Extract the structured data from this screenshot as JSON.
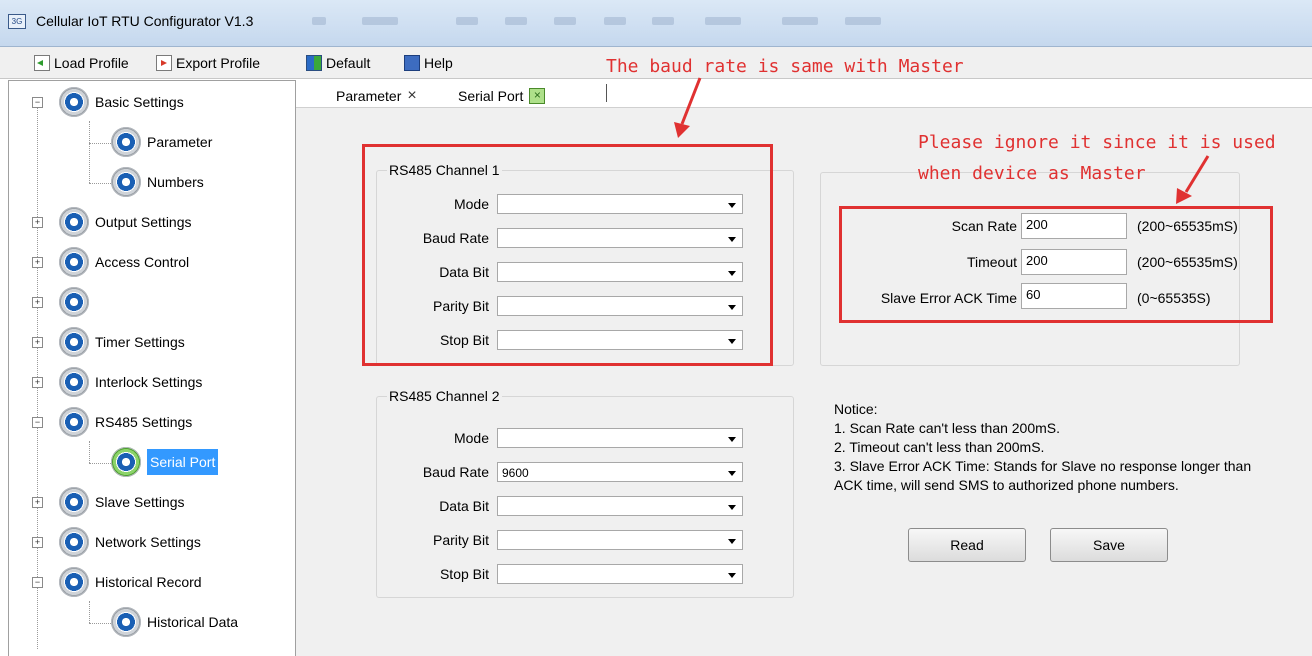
{
  "window": {
    "title": "Cellular IoT RTU Configurator V1.3"
  },
  "toolbar": {
    "load_profile": "Load Profile",
    "export_profile": "Export Profile",
    "default": "Default",
    "help": "Help"
  },
  "tree": {
    "items": [
      {
        "label": "Basic Settings",
        "expanded": true
      },
      {
        "label": "Parameter"
      },
      {
        "label": "Numbers"
      },
      {
        "label": "Output Settings",
        "expanded": false
      },
      {
        "label": "Access Control",
        "expanded": false
      },
      {
        "label": "",
        "expanded": false
      },
      {
        "label": "Timer Settings",
        "expanded": false
      },
      {
        "label": "Interlock Settings",
        "expanded": false
      },
      {
        "label": "RS485 Settings",
        "expanded": true
      },
      {
        "label": "Serial Port",
        "selected": true
      },
      {
        "label": "Slave Settings",
        "expanded": false
      },
      {
        "label": "Network Settings",
        "expanded": false
      },
      {
        "label": "Historical Record",
        "expanded": true
      },
      {
        "label": "Historical Data"
      }
    ]
  },
  "tabs": [
    {
      "label": "Parameter",
      "close": "×"
    },
    {
      "label": "Serial Port",
      "close": "×",
      "active": true
    }
  ],
  "channel1": {
    "title": "RS485 Channel 1",
    "fields": [
      {
        "label": "Mode",
        "value": ""
      },
      {
        "label": "Baud Rate",
        "value": ""
      },
      {
        "label": "Data Bit",
        "value": ""
      },
      {
        "label": "Parity Bit",
        "value": ""
      },
      {
        "label": "Stop Bit",
        "value": ""
      }
    ]
  },
  "channel2": {
    "title": "RS485 Channel 2",
    "fields": [
      {
        "label": "Mode",
        "value": ""
      },
      {
        "label": "Baud Rate",
        "value": "9600"
      },
      {
        "label": "Data Bit",
        "value": ""
      },
      {
        "label": "Parity Bit",
        "value": ""
      },
      {
        "label": "Stop Bit",
        "value": ""
      }
    ]
  },
  "master": {
    "fields": [
      {
        "label": "Scan Rate",
        "value": "200",
        "range": "(200~65535mS)"
      },
      {
        "label": "Timeout",
        "value": "200",
        "range": "(200~65535mS)"
      },
      {
        "label": "Slave Error ACK Time",
        "value": "60",
        "range": "(0~65535S)"
      }
    ]
  },
  "notice": {
    "heading": "Notice:",
    "lines": [
      "1. Scan Rate can't less than 200mS.",
      "2. Timeout  can't less than 200mS.",
      "3. Slave Error ACK Time: Stands for Slave no response longer than ACK time, will send SMS to authorized phone numbers."
    ]
  },
  "buttons": {
    "read": "Read",
    "save": "Save"
  },
  "annotations": {
    "baud": "The baud rate is same with Master",
    "ignore_line1": "Please ignore it since it is used",
    "ignore_line2": "when device as Master"
  },
  "colors": {
    "annotation": "#e03131",
    "selection": "#3399ff"
  }
}
